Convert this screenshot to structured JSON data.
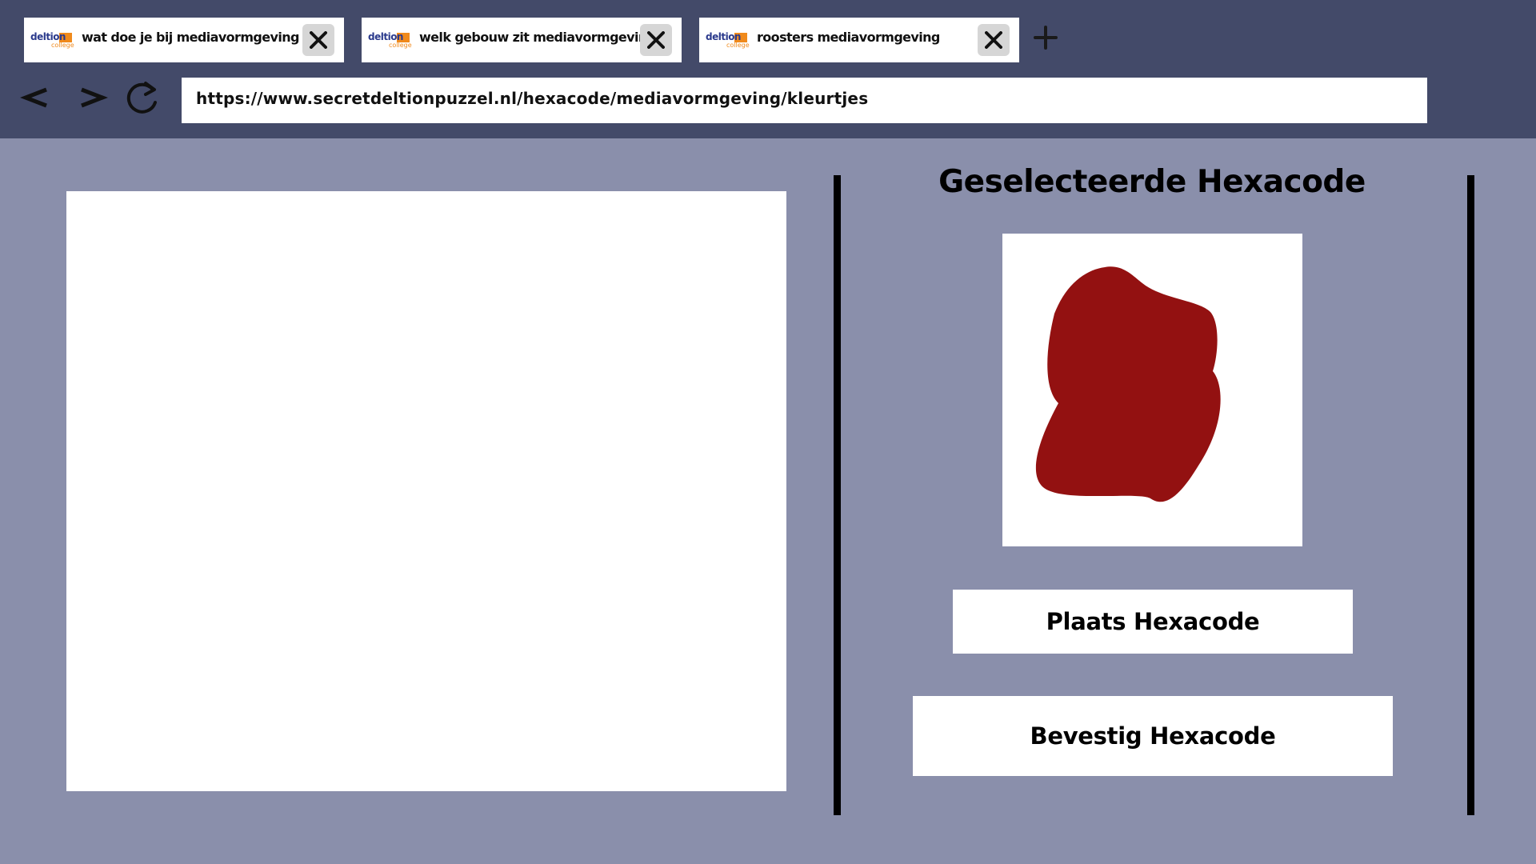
{
  "browser": {
    "tabs": [
      {
        "logo_text": "deltion",
        "logo_sub": "college",
        "title": "wat doe je bij mediavormgeving"
      },
      {
        "logo_text": "deltion",
        "logo_sub": "college",
        "title": "welk gebouw zit mediavormgeving"
      },
      {
        "logo_text": "deltion",
        "logo_sub": "college",
        "title": "roosters mediavormgeving"
      }
    ],
    "url": "https://www.secretdeltionpuzzel.nl/hexacode/mediavormgeving/kleurtjes"
  },
  "panel": {
    "title": "Geselecteerde Hexacode",
    "selected_color": "#931111",
    "place_button": "Plaats Hexacode",
    "confirm_button": "Bevestig Hexacode"
  },
  "colors": {
    "chrome_bg": "#434a69",
    "page_bg": "#8a8fab",
    "logo_blue": "#2b3a8c",
    "logo_orange": "#f08a1c"
  },
  "icons": {
    "tab_close": "close-icon",
    "new_tab": "plus-icon",
    "back": "chevron-left-icon",
    "forward": "chevron-right-icon",
    "reload": "reload-icon"
  }
}
